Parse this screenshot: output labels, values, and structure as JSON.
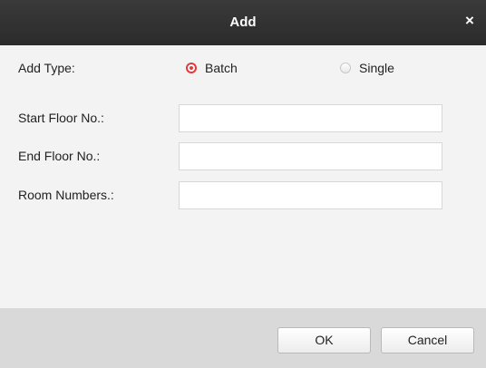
{
  "dialog": {
    "title": "Add",
    "close_label": "×"
  },
  "form": {
    "add_type_label": "Add Type:",
    "add_type_options": [
      {
        "label": "Batch",
        "checked": true
      },
      {
        "label": "Single",
        "checked": false
      }
    ],
    "start_floor": {
      "label": "Start Floor No.:",
      "value": "",
      "placeholder": ""
    },
    "end_floor": {
      "label": "End Floor No.:",
      "value": "",
      "placeholder": ""
    },
    "room_numbers": {
      "label": "Room Numbers.:",
      "value": "",
      "placeholder": ""
    }
  },
  "buttons": {
    "ok_label": "OK",
    "cancel_label": "Cancel"
  },
  "colors": {
    "titlebar": "#2f2f2f",
    "radio_checked": "#e43a3a",
    "footer": "#d9d9d9",
    "body": "#f3f3f3"
  }
}
